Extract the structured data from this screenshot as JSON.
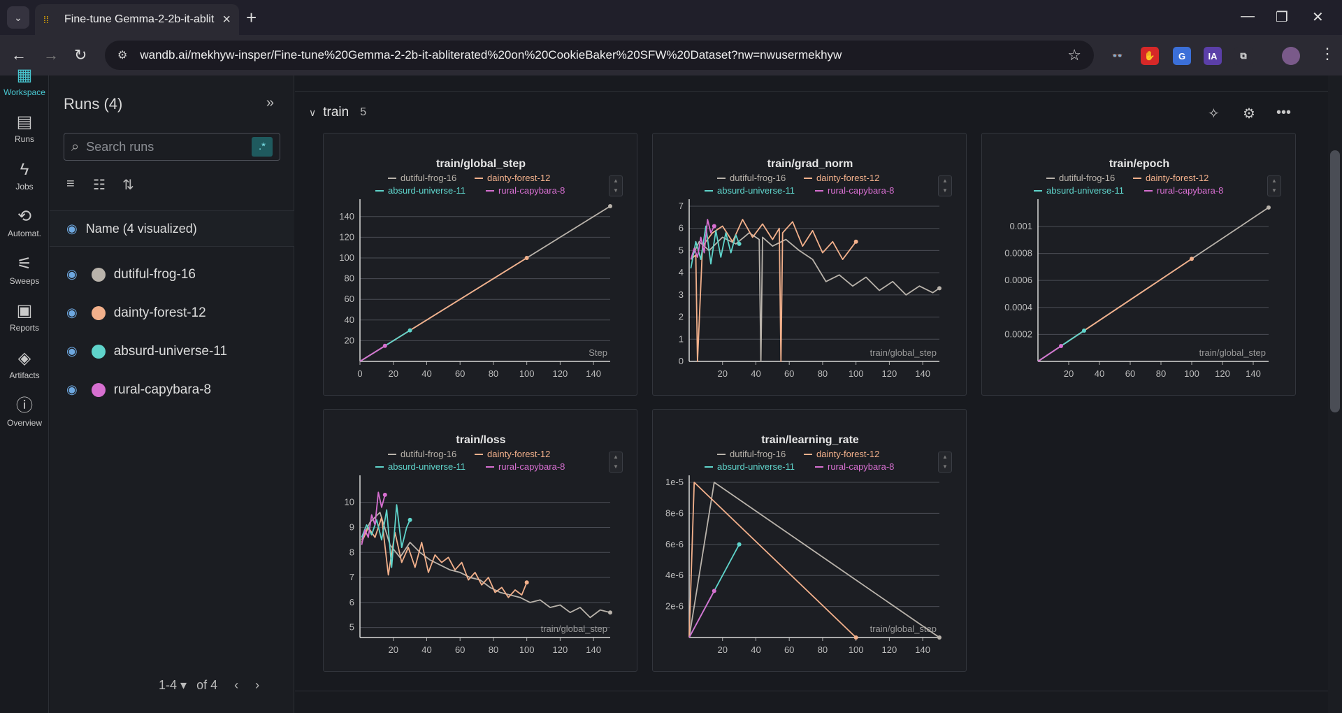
{
  "browser": {
    "tab_title": "Fine-tune Gemma-2-2b-it-ablit",
    "url": "wandb.ai/mekhyw-insper/Fine-tune%20Gemma-2-2b-it-abliterated%20on%20CookieBaker%20SFW%20Dataset?nw=nwusermekhyw",
    "extensions": [
      {
        "name": "spy-icon",
        "label": "👓",
        "bg": "#2b2a33",
        "fg": "#ddd"
      },
      {
        "name": "stop-icon",
        "label": "✋",
        "bg": "#d62828",
        "fg": "#fff"
      },
      {
        "name": "translate-icon",
        "label": "G",
        "bg": "#3b6fd8",
        "fg": "#fff"
      },
      {
        "name": "ia-icon",
        "label": "IA",
        "bg": "#5b3fa8",
        "fg": "#fff"
      },
      {
        "name": "extensions-icon",
        "label": "⧉",
        "bg": "#2b2a33",
        "fg": "#ddd"
      }
    ]
  },
  "leftnav": [
    {
      "label": "Workspace",
      "icon": "▦",
      "active": true
    },
    {
      "label": "Runs",
      "icon": "▤",
      "active": false
    },
    {
      "label": "Jobs",
      "icon": "ϟ",
      "active": false
    },
    {
      "label": "Automat.",
      "icon": "⟲",
      "active": false
    },
    {
      "label": "Sweeps",
      "icon": "⚟",
      "active": false
    },
    {
      "label": "Reports",
      "icon": "▣",
      "active": false
    },
    {
      "label": "Artifacts",
      "icon": "◈",
      "active": false
    },
    {
      "label": "Overview",
      "icon": "ⓘ",
      "active": false
    }
  ],
  "runs_panel": {
    "title": "Runs (4)",
    "search_placeholder": "Search runs",
    "regex_label": ".*",
    "name_header": "Name (4 visualized)",
    "runs": [
      {
        "name": "dutiful-frog-16",
        "color": "#b9b3ab"
      },
      {
        "name": "dainty-forest-12",
        "color": "#f2b08b"
      },
      {
        "name": "absurd-universe-11",
        "color": "#5fd4cb"
      },
      {
        "name": "rural-capybara-8",
        "color": "#d66fd0"
      }
    ],
    "pager": {
      "range": "1-4",
      "of": "of 4"
    }
  },
  "section": {
    "name": "train",
    "count": "5"
  },
  "charts": [
    {
      "title": "train/global_step",
      "xlabel": "Step"
    },
    {
      "title": "train/grad_norm",
      "xlabel": "train/global_step"
    },
    {
      "title": "train/epoch",
      "xlabel": "train/global_step"
    },
    {
      "title": "train/loss",
      "xlabel": "train/global_step"
    },
    {
      "title": "train/learning_rate",
      "xlabel": "train/global_step"
    }
  ],
  "chart_data": [
    {
      "type": "line",
      "title": "train/global_step",
      "xlabel": "Step",
      "ylabel": "",
      "xlim": [
        0,
        150
      ],
      "ylim": [
        0,
        150
      ],
      "xticks": [
        0,
        20,
        40,
        60,
        80,
        100,
        120,
        140
      ],
      "yticks": [
        20,
        40,
        60,
        80,
        100,
        120,
        140
      ],
      "series": [
        {
          "name": "dutiful-frog-16",
          "color": "#b9b3ab",
          "x": [
            0,
            150
          ],
          "y": [
            0,
            150
          ]
        },
        {
          "name": "dainty-forest-12",
          "color": "#f2b08b",
          "x": [
            0,
            100
          ],
          "y": [
            0,
            100
          ]
        },
        {
          "name": "absurd-universe-11",
          "color": "#5fd4cb",
          "x": [
            0,
            30
          ],
          "y": [
            0,
            30
          ]
        },
        {
          "name": "rural-capybara-8",
          "color": "#d66fd0",
          "x": [
            0,
            15
          ],
          "y": [
            0,
            15
          ]
        }
      ]
    },
    {
      "type": "line",
      "title": "train/grad_norm",
      "xlabel": "train/global_step",
      "ylabel": "",
      "xlim": [
        0,
        150
      ],
      "ylim": [
        0,
        7
      ],
      "xticks": [
        20,
        40,
        60,
        80,
        100,
        120,
        140
      ],
      "yticks": [
        0,
        1,
        2,
        3,
        4,
        5,
        6,
        7
      ],
      "series": [
        {
          "name": "dutiful-frog-16",
          "color": "#b9b3ab",
          "x": [
            1,
            6,
            12,
            20,
            28,
            36,
            42,
            43,
            44,
            50,
            58,
            66,
            74,
            82,
            90,
            98,
            106,
            114,
            122,
            130,
            138,
            146,
            150
          ],
          "y": [
            4.6,
            5.4,
            5.0,
            5.6,
            5.3,
            5.8,
            5.5,
            0.0,
            5.6,
            5.2,
            5.5,
            5.0,
            4.6,
            3.6,
            3.9,
            3.4,
            3.8,
            3.2,
            3.6,
            3.0,
            3.4,
            3.1,
            3.3
          ]
        },
        {
          "name": "dainty-forest-12",
          "color": "#f2b08b",
          "x": [
            1,
            4,
            5,
            8,
            14,
            20,
            26,
            32,
            38,
            44,
            50,
            54,
            55,
            56,
            62,
            68,
            74,
            80,
            86,
            92,
            100
          ],
          "y": [
            4.6,
            4.8,
            0.0,
            5.2,
            5.8,
            6.1,
            5.4,
            6.4,
            5.6,
            6.2,
            5.5,
            6.0,
            0.0,
            5.8,
            6.3,
            5.2,
            5.9,
            4.9,
            5.4,
            4.6,
            5.4
          ]
        },
        {
          "name": "absurd-universe-11",
          "color": "#5fd4cb",
          "x": [
            1,
            4,
            7,
            10,
            13,
            16,
            19,
            22,
            25,
            28,
            30
          ],
          "y": [
            4.2,
            5.4,
            4.6,
            6.1,
            4.4,
            5.9,
            4.7,
            5.8,
            4.9,
            5.7,
            5.3
          ]
        },
        {
          "name": "rural-capybara-8",
          "color": "#d66fd0",
          "x": [
            1,
            3,
            5,
            7,
            9,
            11,
            13,
            15
          ],
          "y": [
            4.6,
            5.1,
            4.7,
            5.6,
            4.9,
            6.4,
            5.8,
            6.1
          ]
        }
      ]
    },
    {
      "type": "line",
      "title": "train/epoch",
      "xlabel": "train/global_step",
      "ylabel": "",
      "xlim": [
        0,
        150
      ],
      "ylim": [
        0,
        0.00115
      ],
      "xticks": [
        20,
        40,
        60,
        80,
        100,
        120,
        140
      ],
      "yticks": [
        0.0002,
        0.0004,
        0.0006,
        0.0008,
        0.001
      ],
      "ytick_labels": [
        "0.0002",
        "0.0004",
        "0.0006",
        "0.0008",
        "0.001"
      ],
      "series": [
        {
          "name": "dutiful-frog-16",
          "color": "#b9b3ab",
          "x": [
            0,
            150
          ],
          "y": [
            0,
            0.00114
          ]
        },
        {
          "name": "dainty-forest-12",
          "color": "#f2b08b",
          "x": [
            0,
            100
          ],
          "y": [
            0,
            0.00076
          ]
        },
        {
          "name": "absurd-universe-11",
          "color": "#5fd4cb",
          "x": [
            0,
            30
          ],
          "y": [
            0,
            0.000228
          ]
        },
        {
          "name": "rural-capybara-8",
          "color": "#d66fd0",
          "x": [
            0,
            15
          ],
          "y": [
            0,
            0.000114
          ]
        }
      ]
    },
    {
      "type": "line",
      "title": "train/loss",
      "xlabel": "train/global_step",
      "ylabel": "",
      "xlim": [
        0,
        150
      ],
      "ylim": [
        4.6,
        10.8
      ],
      "xticks": [
        20,
        40,
        60,
        80,
        100,
        120,
        140
      ],
      "yticks": [
        5,
        6,
        7,
        8,
        9,
        10
      ],
      "series": [
        {
          "name": "dutiful-frog-16",
          "color": "#b9b3ab",
          "x": [
            1,
            6,
            12,
            18,
            24,
            30,
            36,
            42,
            48,
            54,
            60,
            66,
            72,
            78,
            84,
            90,
            96,
            102,
            108,
            114,
            120,
            126,
            132,
            138,
            144,
            150
          ],
          "y": [
            8.5,
            9.2,
            9.6,
            8.3,
            7.8,
            8.4,
            8.0,
            7.7,
            7.5,
            7.3,
            7.2,
            7.0,
            6.9,
            6.6,
            6.4,
            6.3,
            6.2,
            6.0,
            6.1,
            5.8,
            5.9,
            5.6,
            5.8,
            5.4,
            5.7,
            5.6
          ]
        },
        {
          "name": "dainty-forest-12",
          "color": "#f2b08b",
          "x": [
            1,
            5,
            9,
            13,
            17,
            21,
            25,
            29,
            33,
            37,
            41,
            45,
            49,
            53,
            57,
            61,
            65,
            69,
            73,
            77,
            81,
            85,
            89,
            93,
            97,
            100
          ],
          "y": [
            8.4,
            9.0,
            8.6,
            9.4,
            7.1,
            8.8,
            7.6,
            8.2,
            7.4,
            8.4,
            7.2,
            7.9,
            7.6,
            7.8,
            7.3,
            7.6,
            6.9,
            7.2,
            6.7,
            7.0,
            6.4,
            6.6,
            6.2,
            6.5,
            6.3,
            6.8
          ]
        },
        {
          "name": "absurd-universe-11",
          "color": "#5fd4cb",
          "x": [
            1,
            4,
            7,
            10,
            13,
            16,
            19,
            22,
            25,
            28,
            30
          ],
          "y": [
            8.6,
            9.1,
            8.7,
            9.3,
            8.5,
            9.7,
            7.4,
            9.9,
            8.2,
            9.0,
            9.3
          ]
        },
        {
          "name": "rural-capybara-8",
          "color": "#d66fd0",
          "x": [
            1,
            3,
            5,
            7,
            9,
            11,
            13,
            15
          ],
          "y": [
            8.3,
            8.9,
            8.6,
            9.5,
            9.1,
            10.4,
            9.8,
            10.3
          ]
        }
      ]
    },
    {
      "type": "line",
      "title": "train/learning_rate",
      "xlabel": "train/global_step",
      "ylabel": "",
      "xlim": [
        0,
        150
      ],
      "ylim": [
        0,
        1e-05
      ],
      "xticks": [
        20,
        40,
        60,
        80,
        100,
        120,
        140
      ],
      "yticks": [
        2e-06,
        4e-06,
        6e-06,
        8e-06,
        1e-05
      ],
      "ytick_labels": [
        "2e-6",
        "4e-6",
        "6e-6",
        "8e-6",
        "1e-5"
      ],
      "series": [
        {
          "name": "dutiful-frog-16",
          "color": "#b9b3ab",
          "x": [
            0,
            15,
            150
          ],
          "y": [
            0,
            1e-05,
            0
          ]
        },
        {
          "name": "dainty-forest-12",
          "color": "#f2b08b",
          "x": [
            0,
            3,
            100
          ],
          "y": [
            0,
            1e-05,
            0
          ]
        },
        {
          "name": "absurd-universe-11",
          "color": "#5fd4cb",
          "x": [
            0,
            30
          ],
          "y": [
            0,
            6e-06
          ]
        },
        {
          "name": "rural-capybara-8",
          "color": "#d66fd0",
          "x": [
            0,
            15
          ],
          "y": [
            0,
            3e-06
          ]
        }
      ]
    }
  ]
}
